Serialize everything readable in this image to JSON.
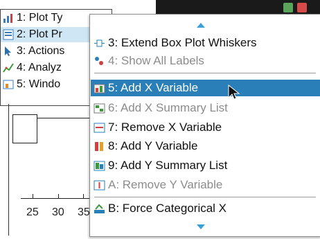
{
  "left_menu": {
    "items": [
      {
        "label": "1: Plot Ty"
      },
      {
        "label": "2: Plot Pr"
      },
      {
        "label": "3: Actions"
      },
      {
        "label": "4: Analyz"
      },
      {
        "label": "5: Windo"
      }
    ]
  },
  "plot": {
    "tick_labels": [
      "25",
      "30",
      "35"
    ]
  },
  "context_menu": {
    "items": [
      {
        "label": "3: Extend Box Plot Whiskers",
        "icon": "whiskers-icon",
        "disabled": false
      },
      {
        "label": "4: Show All Labels",
        "icon": "labels-icon",
        "disabled": true
      },
      {
        "label": "5: Add X Variable",
        "icon": "add-x-variable-icon",
        "disabled": false,
        "highlighted": true
      },
      {
        "label": "6: Add X Summary List",
        "icon": "add-x-summary-icon",
        "disabled": true
      },
      {
        "label": "7: Remove X Variable",
        "icon": "remove-x-variable-icon",
        "disabled": false
      },
      {
        "label": "8: Add Y Variable",
        "icon": "add-y-variable-icon",
        "disabled": false
      },
      {
        "label": "9: Add Y Summary List",
        "icon": "add-y-summary-icon",
        "disabled": false
      },
      {
        "label": "A: Remove Y Variable",
        "icon": "remove-y-variable-icon",
        "disabled": true
      },
      {
        "label": "B: Force Categorical X",
        "icon": "categorical-x-icon",
        "disabled": false
      }
    ]
  },
  "colors": {
    "highlight": "#2a7fb8",
    "scroll_arrow": "#3aa0d8",
    "disabled_text": "#8c8c8c"
  }
}
